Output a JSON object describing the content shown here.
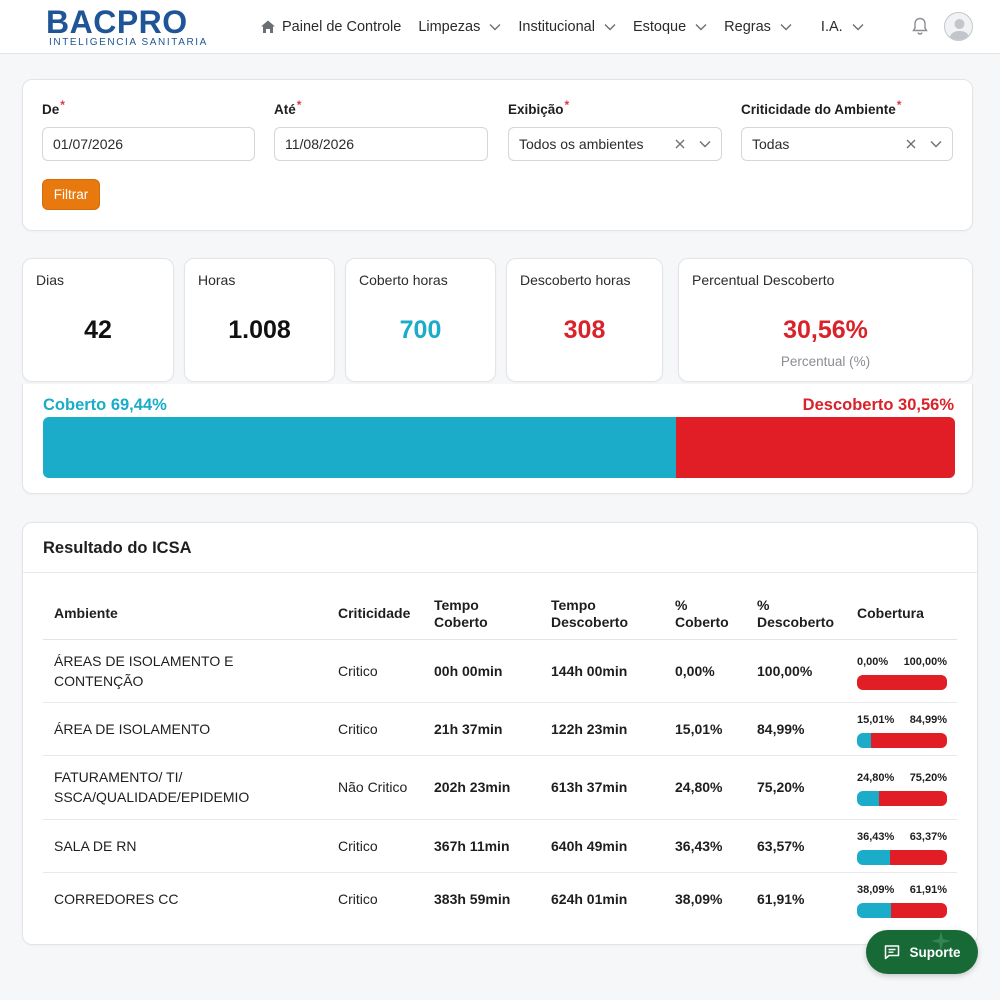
{
  "brand": {
    "name": "BACPRO",
    "tagline": "INTELIGENCIA SANITARIA",
    "color": "#1f5596"
  },
  "nav": {
    "home_label": "Painel de Controle",
    "items": [
      "Limpezas",
      "Institucional",
      "Estoque",
      "Regras",
      "I.A."
    ]
  },
  "filters": {
    "from": {
      "label": "De",
      "value": "01/07/2026"
    },
    "to": {
      "label": "Até",
      "value": "11/08/2026"
    },
    "display": {
      "label": "Exibição",
      "value": "Todos os ambientes"
    },
    "criticality": {
      "label": "Criticidade do Ambiente",
      "value": "Todas"
    },
    "required_mark": "*",
    "button": "Filtrar"
  },
  "stats": {
    "days": {
      "label": "Dias",
      "value": "42"
    },
    "hours": {
      "label": "Horas",
      "value": "1.008"
    },
    "covered": {
      "label": "Coberto horas",
      "value": "700"
    },
    "uncovered": {
      "label": "Descoberto horas",
      "value": "308"
    },
    "percent": {
      "label": "Percentual Descoberto",
      "value": "30,56%",
      "sub": "Percentual (%)"
    }
  },
  "coverage_bar": {
    "covered_label": "Coberto 69,44%",
    "uncovered_label": "Descoberto 30,56%",
    "covered_fraction": 0.6944
  },
  "table": {
    "title": "Resultado do ICSA",
    "headers": {
      "ambiente": "Ambiente",
      "criticidade": "Criticidade",
      "tempo_coberto_1": "Tempo",
      "tempo_coberto_2": "Coberto",
      "tempo_descoberto_1": "Tempo",
      "tempo_descoberto_2": "Descoberto",
      "pct_coberto_1": "%",
      "pct_coberto_2": "Coberto",
      "pct_descoberto_1": "%",
      "pct_descoberto_2": "Descoberto",
      "cobertura": "Cobertura"
    },
    "rows": [
      {
        "ambiente_1": "ÁREAS DE ISOLAMENTO E",
        "ambiente_2": "CONTENÇÃO",
        "criticidade": "Critico",
        "tempo_coberto": "00h 00min",
        "tempo_descoberto": "144h 00min",
        "pct_coberto": "0,00%",
        "pct_descoberto": "100,00%",
        "bar_left": "0,00%",
        "bar_right": "100,00%",
        "fraction": 0.0
      },
      {
        "ambiente_1": "ÁREA DE ISOLAMENTO",
        "ambiente_2": "",
        "criticidade": "Critico",
        "tempo_coberto": "21h 37min",
        "tempo_descoberto": "122h 23min",
        "pct_coberto": "15,01%",
        "pct_descoberto": "84,99%",
        "bar_left": "15,01%",
        "bar_right": "84,99%",
        "fraction": 0.1501
      },
      {
        "ambiente_1": "FATURAMENTO/ TI/",
        "ambiente_2": "SSCA/QUALIDADE/EPIDEMIO",
        "criticidade": "Não Critico",
        "tempo_coberto": "202h 23min",
        "tempo_descoberto": "613h 37min",
        "pct_coberto": "24,80%",
        "pct_descoberto": "75,20%",
        "bar_left": "24,80%",
        "bar_right": "75,20%",
        "fraction": 0.248
      },
      {
        "ambiente_1": "SALA DE RN",
        "ambiente_2": "",
        "criticidade": "Critico",
        "tempo_coberto": "367h 11min",
        "tempo_descoberto": "640h 49min",
        "pct_coberto": "36,43%",
        "pct_descoberto": "63,57%",
        "bar_left": "36,43%",
        "bar_right": "63,37%",
        "fraction": 0.3643
      },
      {
        "ambiente_1": "CORREDORES CC",
        "ambiente_2": "",
        "criticidade": "Critico",
        "tempo_coberto": "383h 59min",
        "tempo_descoberto": "624h 01min",
        "pct_coberto": "38,09%",
        "pct_descoberto": "61,91%",
        "bar_left": "38,09%",
        "bar_right": "61,91%",
        "fraction": 0.3809
      }
    ]
  },
  "support": {
    "label": "Suporte"
  },
  "colors": {
    "covered": "#1aacc8",
    "uncovered": "#e11d25",
    "accent": "#e8790f",
    "support": "#176a36"
  },
  "icons": [
    "home-icon",
    "chevron-down-icon",
    "bell-icon",
    "avatar-icon",
    "clear-x-icon",
    "chat-icon",
    "sparkle-icon"
  ]
}
